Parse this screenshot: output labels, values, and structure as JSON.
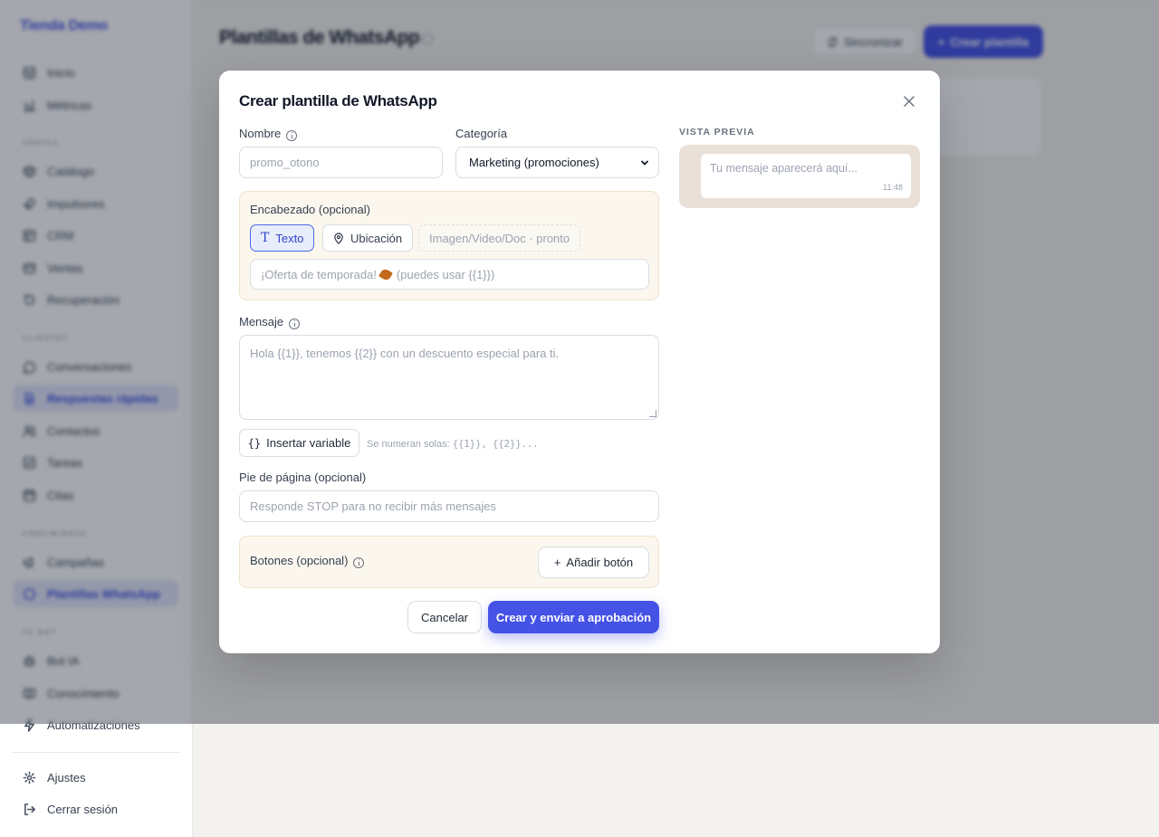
{
  "sidebar": {
    "brand": "Tienda Demo",
    "sections": {
      "ventas": "VENTAS",
      "clientes": "CLIENTES",
      "crecimiento": "CRECIMIENTO",
      "tu_bot": "TU BOT"
    },
    "items": {
      "inicio": "Inicio",
      "metricas": "Métricas",
      "catalogo": "Catálogo",
      "impulsores": "Impulsores",
      "crm": "CRM",
      "ventas": "Ventas",
      "recuperacion": "Recuperación",
      "conversaciones": "Conversaciones",
      "respuestas": "Respuestas rápidas",
      "contactos": "Contactos",
      "tareas": "Tareas",
      "citas": "Citas",
      "campanas": "Campañas",
      "plantillas": "Plantillas WhatsApp",
      "bot": "Bot IA",
      "conocimiento": "Conocimiento",
      "automatizaciones": "Automatizaciones",
      "ajustes": "Ajustes",
      "cerrar": "Cerrar sesión"
    }
  },
  "header": {
    "title": "Plantillas de WhatsApp",
    "sync_label": "Sincronizar",
    "create_label": "Crear plantilla"
  },
  "modal": {
    "title": "Crear plantilla de WhatsApp",
    "nombre_label": "Nombre",
    "nombre_placeholder": "promo_otono",
    "categoria_label": "Categoría",
    "categoria_value": "Marketing (promociones)",
    "encabezado_label": "Encabezado (opcional)",
    "header_options": {
      "texto": "Texto",
      "ubicacion": "Ubicación",
      "media": "Imagen/Video/Doc · pronto"
    },
    "encabezado_placeholder_a": "¡Oferta de temporada!",
    "encabezado_placeholder_b": "(puedes usar {{1}})",
    "mensaje_label": "Mensaje",
    "mensaje_placeholder": "Hola {{1}}, tenemos {{2}} con un descuento especial para ti.",
    "insertar_label": "Insertar variable",
    "hint_text": "Se numeran solas:",
    "hint_code": "{{1}}, {{2}}...",
    "pie_label": "Pie de página (opcional)",
    "pie_placeholder": "Responde STOP para no recibir más mensajes",
    "botones_label": "Botones (opcional)",
    "anadir_boton": "Añadir botón",
    "cancelar": "Cancelar",
    "enviar": "Crear y enviar a aprobación",
    "preview_label": "VISTA PREVIA",
    "preview_placeholder": "Tu mensaje aparecerá aquí...",
    "preview_time": "11:48"
  },
  "colors": {
    "accent": "#4452e6",
    "overlay": "rgba(17,24,39,0.38)",
    "panel": "#fbf7ee",
    "preview_bg": "#e9e0d8"
  }
}
